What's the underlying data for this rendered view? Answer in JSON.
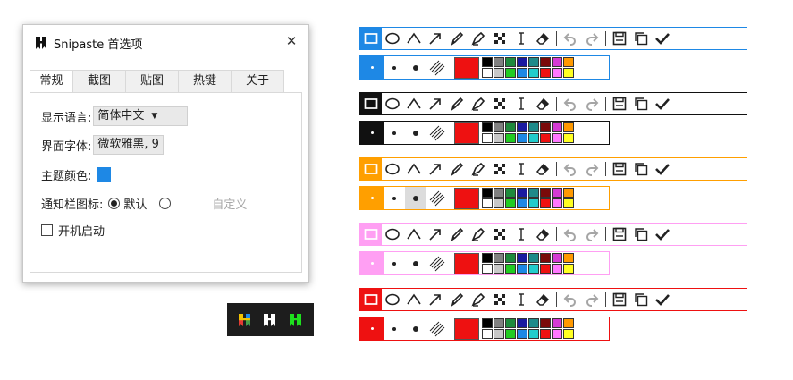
{
  "dialog": {
    "title": "Snipaste 首选项",
    "close": "✕",
    "tabs": [
      {
        "label": "常规",
        "active": true
      },
      {
        "label": "截图",
        "active": false
      },
      {
        "label": "贴图",
        "active": false
      },
      {
        "label": "热键",
        "active": false
      },
      {
        "label": "关于",
        "active": false
      }
    ],
    "language_label": "显示语言:",
    "language_value": "简体中文",
    "font_label": "界面字体:",
    "font_value": "微软雅黑, 9",
    "theme_label": "主题颜色:",
    "theme_color": "#1e88e5",
    "tray_label": "通知栏图标:",
    "tray_default": "默认",
    "tray_custom": "自定义",
    "startup_label": "开机启动"
  },
  "tray_icons": [
    {
      "name": "multicolor-logo",
      "colors": [
        "#f2c200",
        "#e53935",
        "#1e88e5",
        "#43a047"
      ]
    },
    {
      "name": "white-logo",
      "colors": [
        "#ffffff"
      ]
    },
    {
      "name": "green-logo",
      "colors": [
        "#1ee01e"
      ]
    }
  ],
  "toolbars": [
    {
      "theme": "blue",
      "accent": "#1e88e5"
    },
    {
      "theme": "black",
      "accent": "#111111"
    },
    {
      "theme": "orange",
      "accent": "#ff9f00"
    },
    {
      "theme": "pink",
      "accent": "#ff9ff3"
    },
    {
      "theme": "red",
      "accent": "#ee1111"
    }
  ],
  "toolbar_tools": [
    "rectangle-icon",
    "ellipse-icon",
    "polyline-icon",
    "arrow-icon",
    "pencil-icon",
    "marker-icon",
    "mosaic-icon",
    "text-icon",
    "eraser-icon",
    "undo-icon",
    "redo-icon",
    "save-icon",
    "copy-icon",
    "done-icon"
  ],
  "palette": [
    "#000000",
    "#808080",
    "#1e8a3c",
    "#1a1aa0",
    "#1e8a8a",
    "#7a0a0a",
    "#d43ad4",
    "#ff9900",
    "#ffffff",
    "#c8c8c8",
    "#22cc22",
    "#1e88e5",
    "#22cccc",
    "#ee1111",
    "#ff77ff",
    "#ffff22"
  ],
  "current_color": "#ee1111"
}
